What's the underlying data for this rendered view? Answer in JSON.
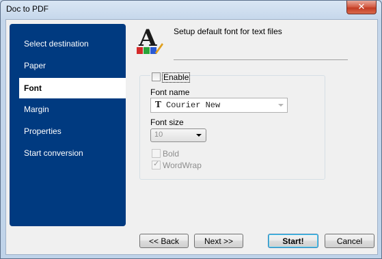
{
  "window": {
    "title": "Doc to PDF",
    "close_glyph": "✕"
  },
  "sidebar": {
    "items": [
      {
        "label": "Select destination"
      },
      {
        "label": "Paper"
      },
      {
        "label": "Font",
        "active": true
      },
      {
        "label": "Margin"
      },
      {
        "label": "Properties"
      },
      {
        "label": "Start conversion"
      }
    ]
  },
  "header": {
    "text": "Setup default font for text files",
    "icon": "font-letter-a-icon"
  },
  "options": {
    "enable_label": "Enable",
    "enable_checked": false,
    "font_name_label": "Font name",
    "font_name_value": "Courier New",
    "font_type_glyph": "T",
    "font_size_label": "Font size",
    "font_size_value": "10",
    "bold_label": "Bold",
    "bold_checked": false,
    "wordwrap_label": "WordWrap",
    "wordwrap_checked": true,
    "check_glyph": "✓"
  },
  "buttons": {
    "back": "<< Back",
    "next": "Next >>",
    "start": "Start!",
    "cancel": "Cancel"
  },
  "colors": {
    "sidebar": "#003a80",
    "close_button": "#c23b23"
  }
}
